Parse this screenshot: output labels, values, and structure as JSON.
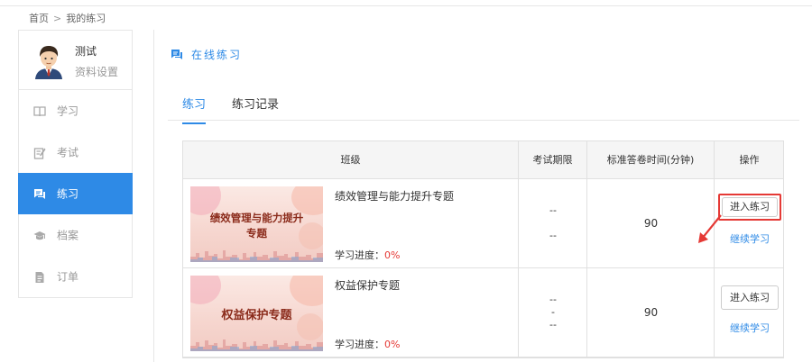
{
  "breadcrumb": {
    "home": "首页",
    "separator": ">",
    "current": "我的练习"
  },
  "user": {
    "name": "测试",
    "settings": "资料设置"
  },
  "sidebar": {
    "items": [
      {
        "label": "学习",
        "icon": "book-icon",
        "active": false
      },
      {
        "label": "考试",
        "icon": "exam-icon",
        "active": false
      },
      {
        "label": "练习",
        "icon": "practice-chat-icon",
        "active": true
      },
      {
        "label": "档案",
        "icon": "graduation-cap-icon",
        "active": false
      },
      {
        "label": "订单",
        "icon": "document-icon",
        "active": false
      }
    ]
  },
  "section": {
    "title": "在线练习",
    "icon": "practice-chat-icon"
  },
  "tabs": [
    {
      "label": "练习",
      "active": true
    },
    {
      "label": "练习记录",
      "active": false
    }
  ],
  "table": {
    "headers": [
      "班级",
      "考试期限",
      "标准答卷时间(分钟)",
      "操作"
    ],
    "rows": [
      {
        "thumb_title": "绩效管理与能力提升专题",
        "thumb_title_line1": "绩效管理与能力提升",
        "thumb_title_line2": "专题",
        "name": "绩效管理与能力提升专题",
        "progress_label": "学习进度：",
        "progress_value": "0%",
        "deadline_lines": [
          "--",
          "--"
        ],
        "duration": "90",
        "enter_label": "进入练习",
        "continue_label": "继续学习",
        "enter_highlighted": true
      },
      {
        "thumb_title": "权益保护专题",
        "name": "权益保护专题",
        "progress_label": "学习进度：",
        "progress_value": "0%",
        "deadline_lines": [
          "--",
          "-",
          "--"
        ],
        "duration": "90",
        "enter_label": "进入练习",
        "continue_label": "继续学习",
        "enter_highlighted": false
      }
    ]
  },
  "colors": {
    "accent": "#2e8ae6",
    "highlight": "#e53935"
  }
}
